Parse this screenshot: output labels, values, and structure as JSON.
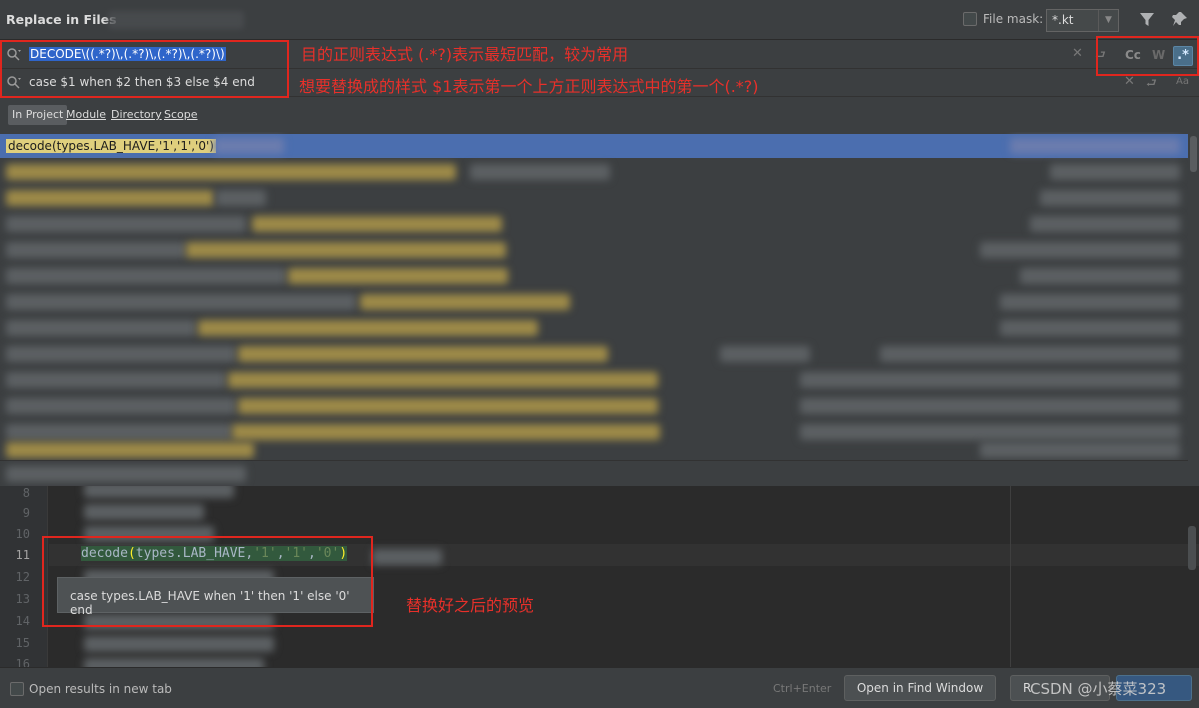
{
  "window": {
    "title": "Replace in Files",
    "file_mask_label": "File mask:",
    "file_mask_value": "*.kt"
  },
  "search": {
    "find_value": "DECODE\\((.*?)\\,(.*?)\\,(.*?)\\,(.*?)\\)",
    "replace_value": "case $1 when $2 then $3 else $4 end",
    "opt_case": "Cc",
    "opt_words": "W",
    "opt_regex": ".*",
    "regex_enabled": true
  },
  "annotations": {
    "find_note": "目的正则表达式 (.*?)表示最短匹配，较为常用",
    "replace_note": "想要替换成的样式 $1表示第一个上方正则表达式中的第一个(.*?)",
    "preview_note": "替换好之后的预览"
  },
  "scope": {
    "tabs": [
      "In Project",
      "Module",
      "Directory",
      "Scope"
    ],
    "active": "In Project"
  },
  "results": {
    "selected_match": "decode(types.LAB_HAVE,'1','1','0')"
  },
  "editor": {
    "line_numbers": [
      "8",
      "9",
      "10",
      "11",
      "12",
      "13",
      "14",
      "15",
      "16"
    ],
    "current_line": "11",
    "code_fn": "decode",
    "code_open": "(",
    "code_arg": "types.LAB_HAVE,",
    "code_s1": "'1'",
    "code_comma1": ",",
    "code_s2": "'1'",
    "code_comma2": ",",
    "code_s3": "'0'",
    "code_close": ")",
    "preview_tooltip": "case types.LAB_HAVE when '1' then '1' else '0' end"
  },
  "footer": {
    "open_new_tab_label": "Open results in new tab",
    "shortcut": "Ctrl+Enter",
    "open_find_window": "Open in Find Window",
    "replace_button_partial": "R",
    "watermark": "CSDN @小蔡菜323"
  },
  "colors": {
    "annotation_red": "#e0261e",
    "selection_blue": "#4b6eaf",
    "match_yellow": "#dfcf7d"
  }
}
